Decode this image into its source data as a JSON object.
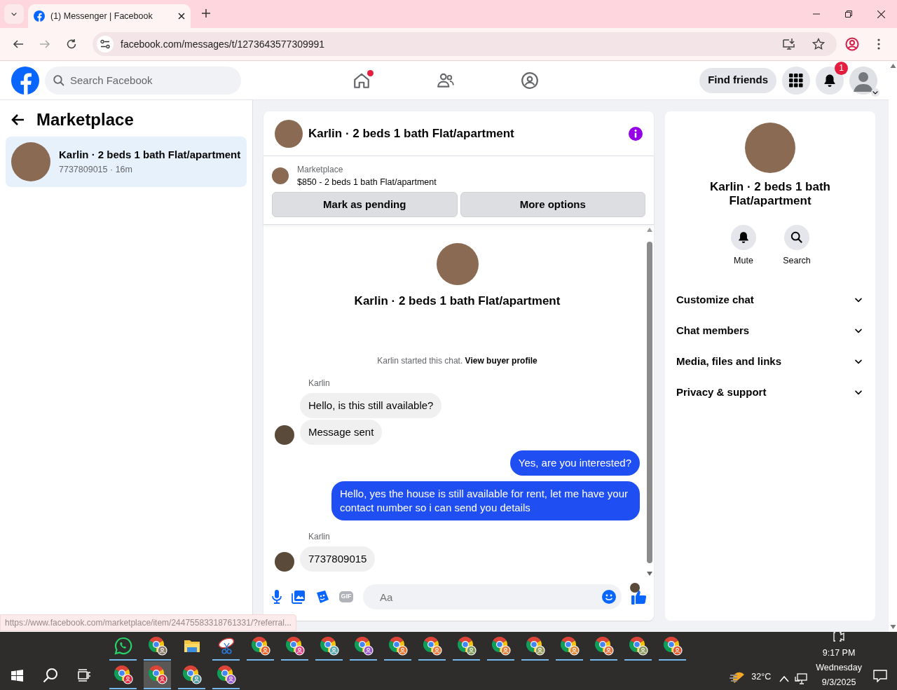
{
  "browser": {
    "tab": {
      "title": "(1) Messenger | Facebook"
    },
    "url": "facebook.com/messages/t/1273643577309991",
    "forward_disabled": true
  },
  "navbar": {
    "search": {
      "placeholder": "Search Facebook"
    },
    "nav_items": [
      {
        "kind": "home",
        "dot": true
      },
      {
        "kind": "friends",
        "dot": false
      },
      {
        "kind": "groups",
        "dot": false
      }
    ],
    "find_friends": "Find friends",
    "notification_count": "1"
  },
  "sidebar": {
    "title": "Marketplace",
    "conversations": [
      {
        "title": "Karlin · 2 beds 1 bath Flat/apartment",
        "subtitle": "7737809015 · 16m",
        "selected": true
      }
    ]
  },
  "chat": {
    "title": "Karlin · 2 beds 1 bath Flat/apartment",
    "listing": {
      "label": "Marketplace",
      "summary": "$850 - 2 beds 1 bath Flat/apartment",
      "buttons": [
        "Mark as pending",
        "More options"
      ]
    },
    "intro": {
      "title": "Karlin · 2 beds 1 bath Flat/apartment",
      "notice": "Karlin started this chat.",
      "link": "View buyer profile"
    },
    "messages": [
      {
        "kind": "incoming",
        "sender": "Karlin",
        "text": "Hello, is this still available?",
        "avatar": false
      },
      {
        "kind": "incoming",
        "text": "Message sent",
        "avatar": true
      },
      {
        "kind": "outgoing",
        "text": "Yes, are you interested?",
        "avatar": false
      },
      {
        "kind": "outgoing",
        "text": "Hello, yes the house is still available for rent, let me have your contact number so i can send you details",
        "avatar": false
      },
      {
        "kind": "incoming",
        "sender": "Karlin",
        "text": "7737809015",
        "avatar": true
      }
    ],
    "composer": {
      "placeholder": "Aa",
      "gif_label": "GIF"
    }
  },
  "details": {
    "title": "Karlin · 2 beds 1 bath Flat/apartment",
    "actions": [
      {
        "kind": "mute",
        "label": "Mute"
      },
      {
        "kind": "search",
        "label": "Search"
      }
    ],
    "sections": [
      {
        "label": "Customize chat",
        "expanded": false
      },
      {
        "label": "Chat members",
        "expanded": false
      },
      {
        "label": "Media, files and links",
        "expanded": false
      },
      {
        "label": "Privacy & support",
        "expanded": false
      }
    ]
  },
  "status_url": "https://www.facebook.com/marketplace/item/24475583318761331/?referral...",
  "taskbar": {
    "rows": [
      [
        {
          "kind": "whatsapp",
          "running": true,
          "selected": false
        },
        {
          "kind": "browser",
          "color": "#8a7a6a",
          "running": true,
          "selected": false
        },
        {
          "kind": "files",
          "running": false,
          "selected": false
        },
        {
          "kind": "snipping",
          "running": true,
          "selected": false
        },
        {
          "kind": "browser",
          "color": "#e8622c",
          "running": true,
          "selected": false
        },
        {
          "kind": "browser",
          "color": "#e0478a",
          "running": true,
          "selected": false
        },
        {
          "kind": "browser",
          "color": "#5aa8b0",
          "running": true,
          "selected": false
        },
        {
          "kind": "browser",
          "color": "#9b59d0",
          "running": true,
          "selected": false
        },
        {
          "kind": "browser",
          "color": "#e8722c",
          "running": true,
          "selected": false
        },
        {
          "kind": "browser",
          "color": "#e87a3c",
          "running": true,
          "selected": false
        },
        {
          "kind": "browser",
          "color": "#7a9a5a",
          "running": true,
          "selected": false
        },
        {
          "kind": "browser",
          "color": "#e0803a",
          "running": true,
          "selected": false
        },
        {
          "kind": "browser",
          "color": "#9a9a5a",
          "running": true,
          "selected": false
        },
        {
          "kind": "browser",
          "color": "#e08a3a",
          "running": true,
          "selected": false
        },
        {
          "kind": "browser",
          "color": "#e07040",
          "running": true,
          "selected": false
        },
        {
          "kind": "browser",
          "color": "#8a9a5a",
          "running": true,
          "selected": false
        },
        {
          "kind": "browser",
          "color": "#e0582c",
          "running": true,
          "selected": false
        }
      ],
      [
        {
          "kind": "browser",
          "color": "#e0283c",
          "running": true,
          "selected": false
        },
        {
          "kind": "browser",
          "color": "#e0283c",
          "running": true,
          "selected": true
        },
        {
          "kind": "browser",
          "color": "#4a9aa0",
          "running": true,
          "selected": false
        },
        {
          "kind": "browser",
          "color": "#9b59d0",
          "running": true,
          "selected": false
        }
      ]
    ],
    "tray": {
      "weather": "32°C",
      "time": "9:17 PM",
      "day": "Wednesday",
      "date": "9/3/2025"
    }
  }
}
